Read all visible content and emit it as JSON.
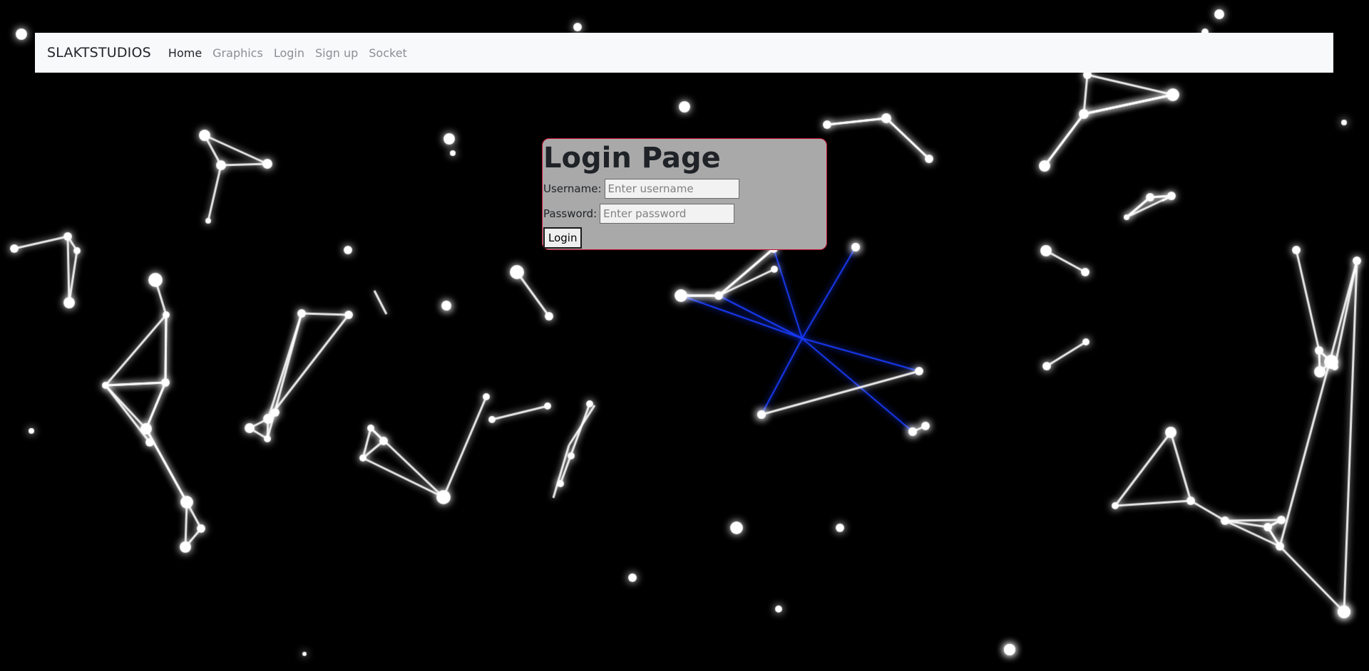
{
  "navbar": {
    "brand": "SLAKTSTUDIOS",
    "links": [
      {
        "label": "Home",
        "active": true
      },
      {
        "label": "Graphics",
        "active": false
      },
      {
        "label": "Login",
        "active": false
      },
      {
        "label": "Sign up",
        "active": false
      },
      {
        "label": "Socket",
        "active": false
      }
    ]
  },
  "login": {
    "title": "Login Page",
    "username_label": "Username:",
    "username_placeholder": "Enter username",
    "username_value": "",
    "password_label": "Password:",
    "password_placeholder": "Enter password",
    "password_value": "",
    "submit_label": "Login"
  },
  "colors": {
    "background": "#000000",
    "navbar_bg": "#f8f9fa",
    "panel_bg": "#a9a9a9",
    "panel_border": "#c8102e",
    "particle": "#ffffff",
    "highlight_link": "#1a3cff"
  }
}
